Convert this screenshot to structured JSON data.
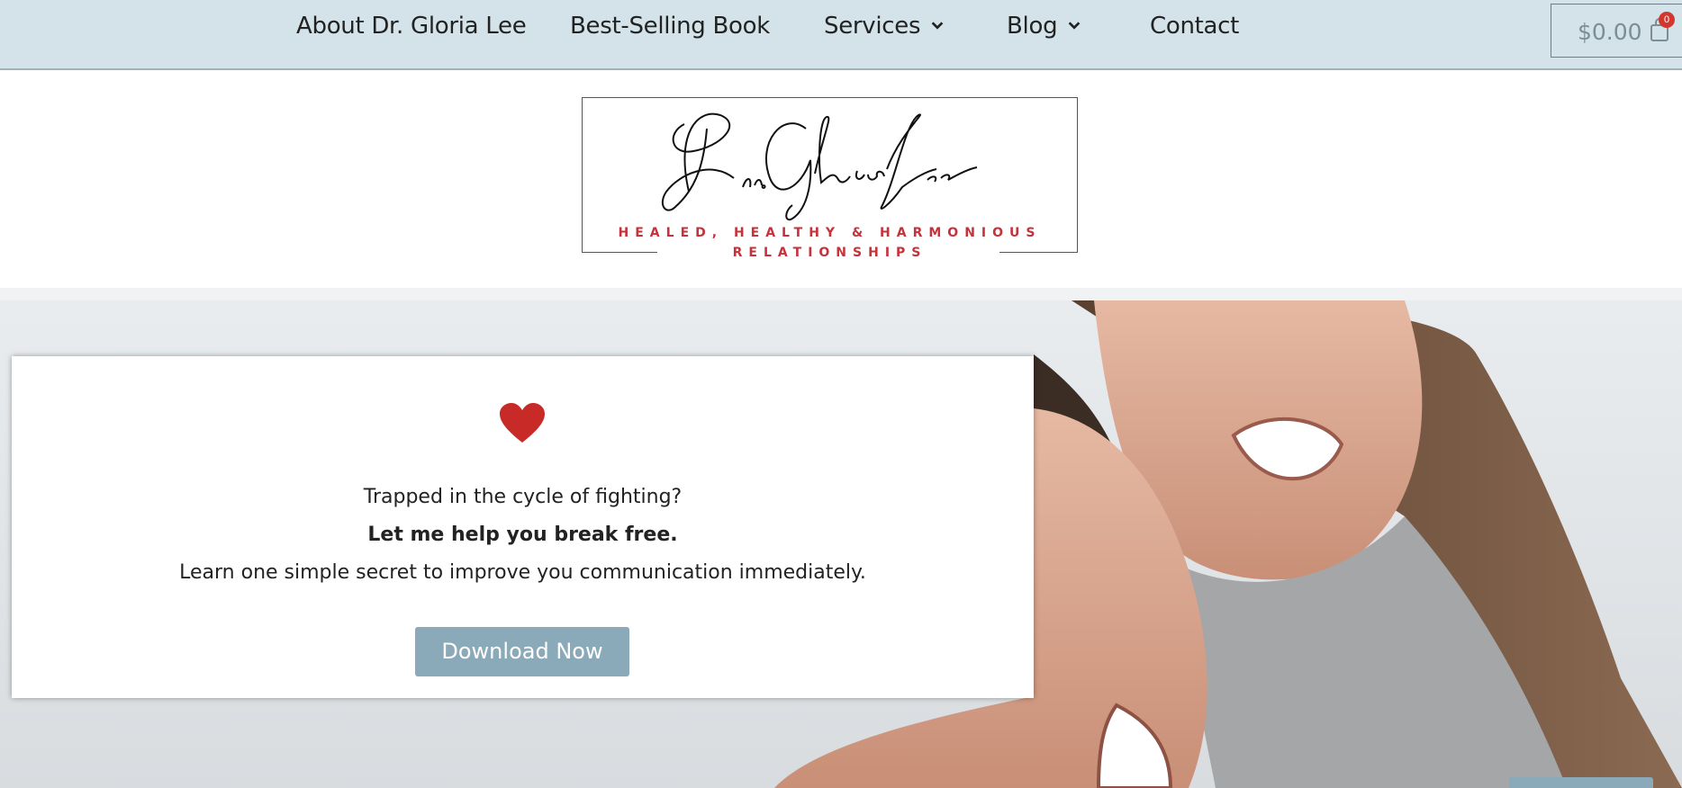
{
  "nav": {
    "items": [
      {
        "label": "About Dr. Gloria Lee",
        "has_dropdown": false
      },
      {
        "label": "Best-Selling Book",
        "has_dropdown": false
      },
      {
        "label": "Services",
        "has_dropdown": true
      },
      {
        "label": "Blog",
        "has_dropdown": true
      },
      {
        "label": "Contact",
        "has_dropdown": false
      }
    ],
    "cart": {
      "amount": "$0.00",
      "count": "0",
      "icon": "shopping-bag-icon"
    }
  },
  "logo": {
    "tagline_line1": "HEALED, HEALTHY & HARMONIOUS",
    "tagline_line2": "RELATIONSHIPS"
  },
  "hero": {
    "icon": "heart-icon",
    "question": "Trapped in the cycle of fighting?",
    "bold_line": "Let me help you break free.",
    "description": "Learn one simple secret to improve you communication immediately.",
    "cta_label": "Download Now"
  },
  "colors": {
    "nav_bg": "#d3e3e9",
    "accent_red": "#c5323a",
    "button_bg": "#8aa9b9"
  }
}
